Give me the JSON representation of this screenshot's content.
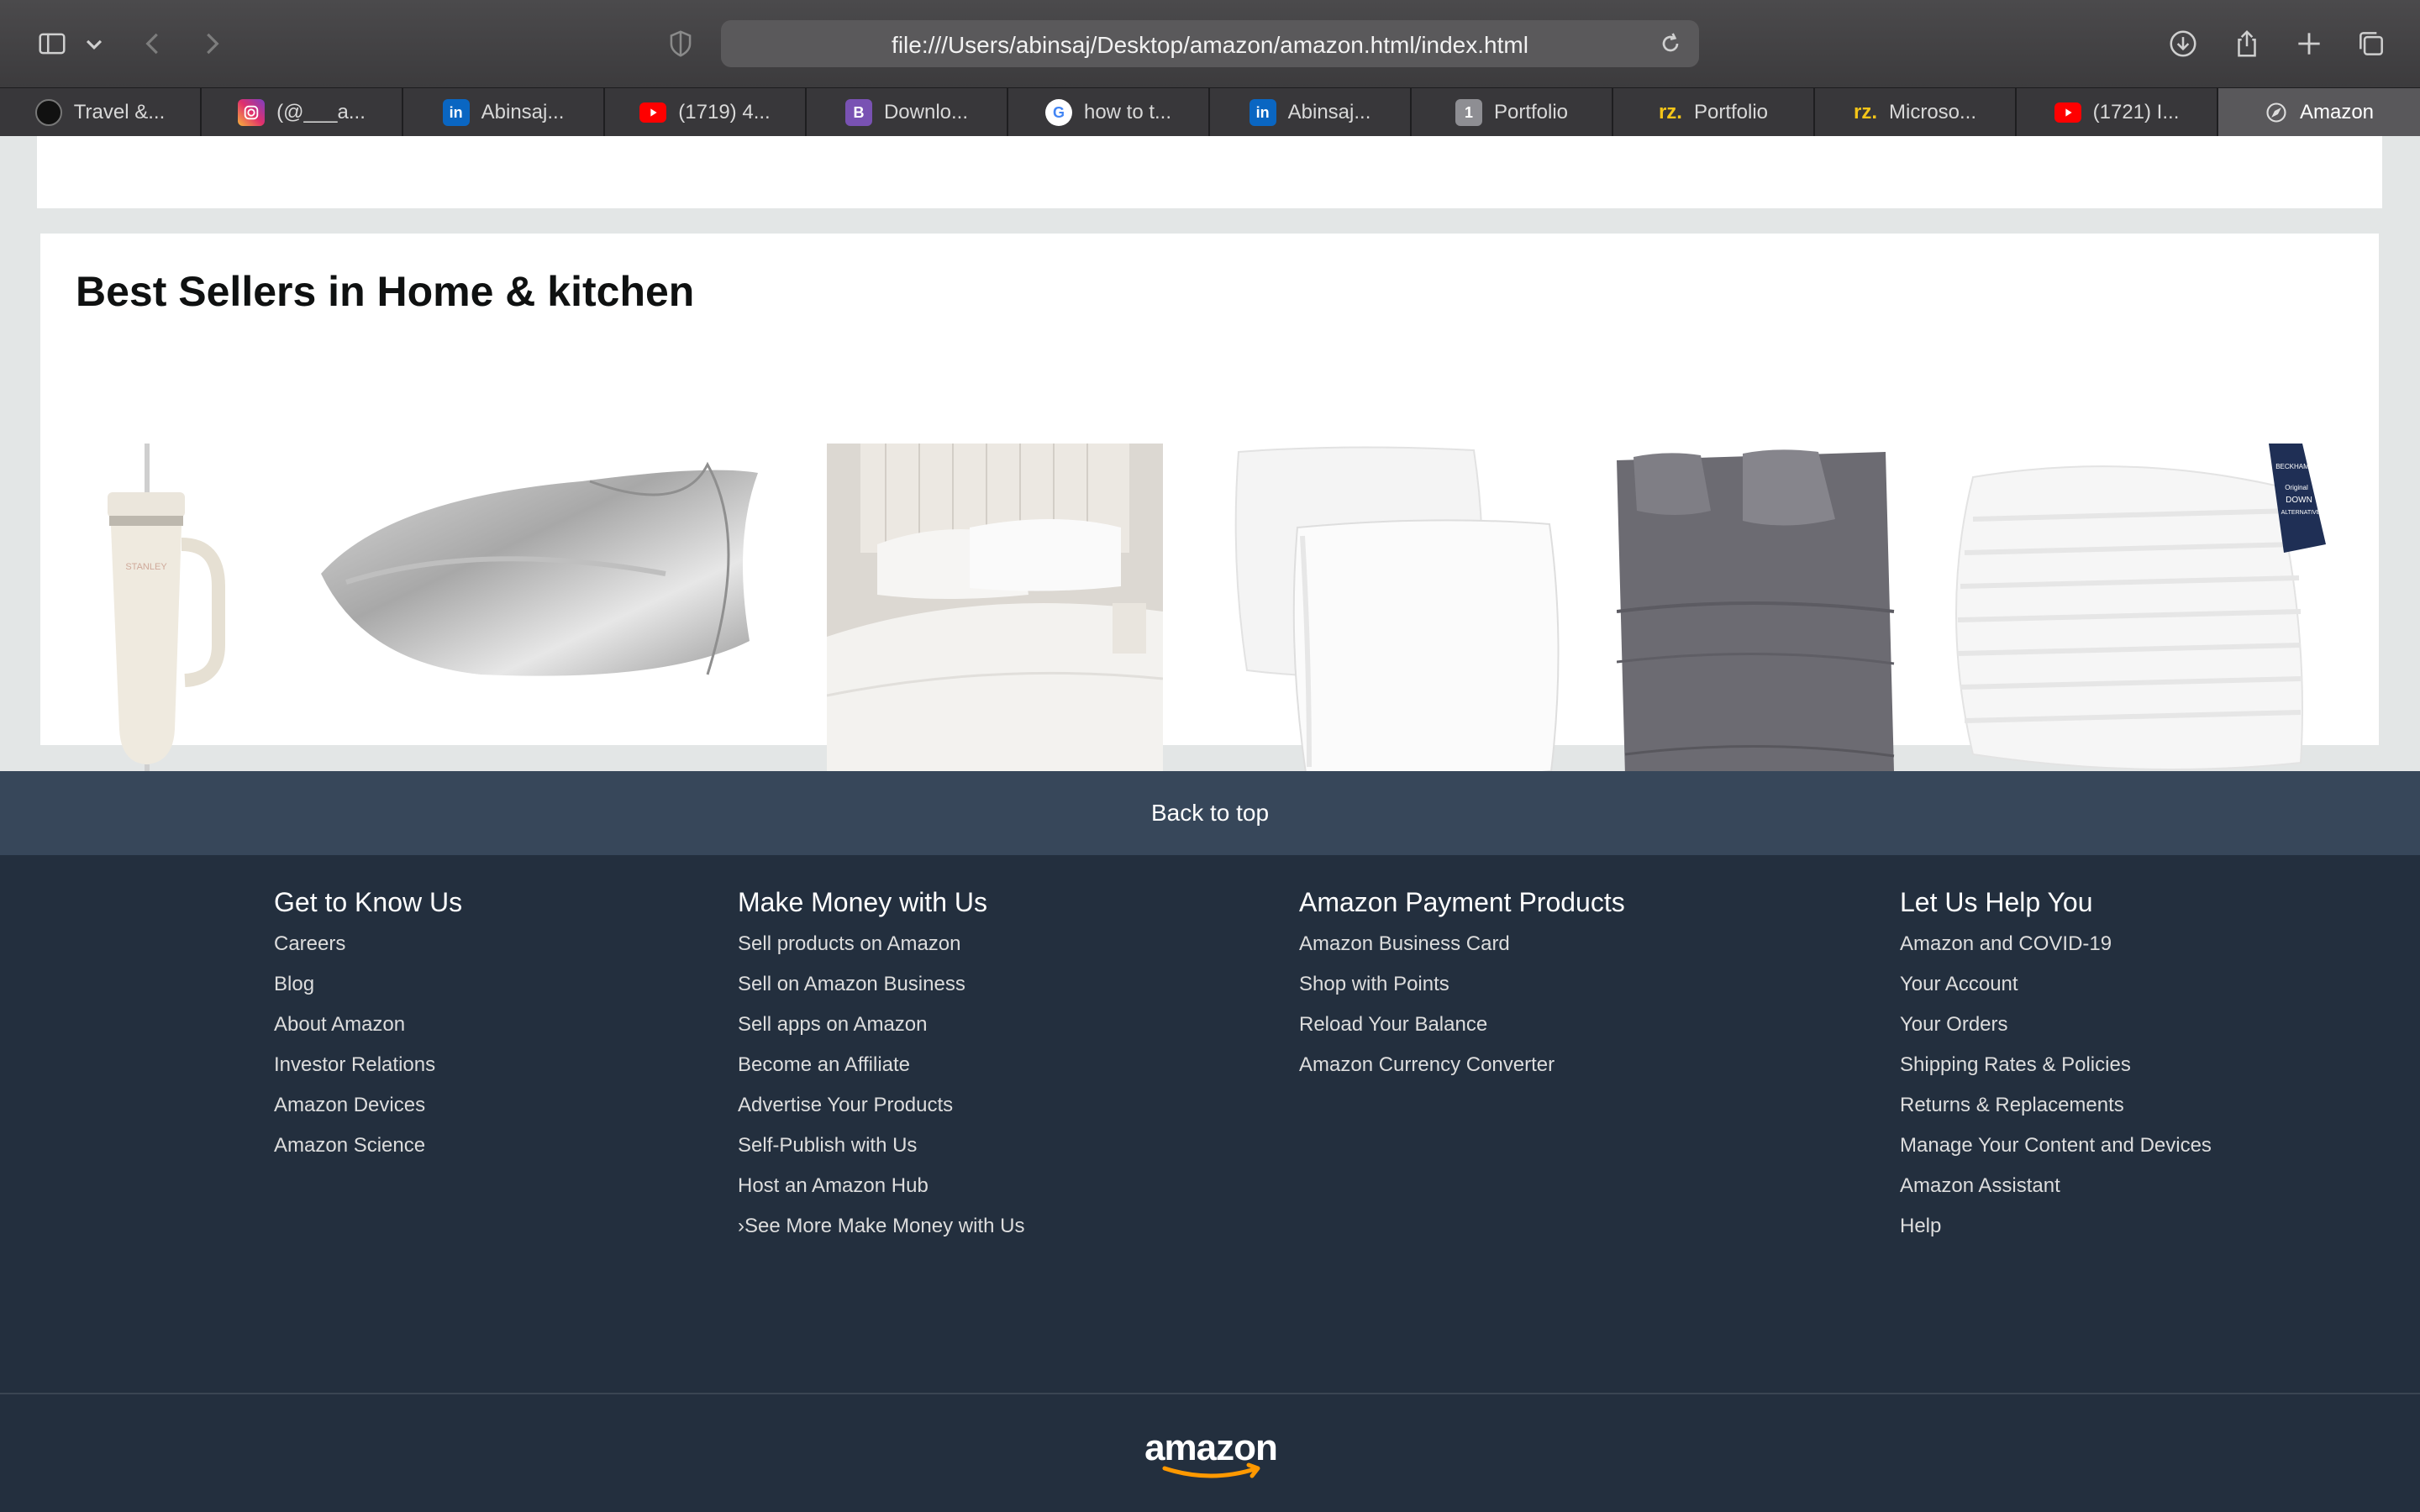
{
  "browser": {
    "url": "file:///Users/abinsaj/Desktop/amazon/amazon.html/index.html",
    "tabs": [
      {
        "label": "Travel &...",
        "icon": "travel-favicon-icon"
      },
      {
        "label": "(@___a...",
        "icon": "instagram-icon"
      },
      {
        "label": "Abinsaj...",
        "icon": "linkedin-icon"
      },
      {
        "label": "(1719) 4...",
        "icon": "youtube-icon"
      },
      {
        "label": "Downlo...",
        "icon": "bootstrap-icon"
      },
      {
        "label": "how to t...",
        "icon": "google-icon"
      },
      {
        "label": "Abinsaj...",
        "icon": "linkedin-icon"
      },
      {
        "label": "Portfolio",
        "icon": "portfolio-one-icon"
      },
      {
        "label": "Portfolio",
        "icon": "rz-icon"
      },
      {
        "label": "Microso...",
        "icon": "rz-icon"
      },
      {
        "label": "(1721) I...",
        "icon": "youtube-icon"
      },
      {
        "label": "Amazon",
        "icon": "compass-icon"
      }
    ],
    "favicon_text": {
      "linkedin": "in",
      "bootstrap": "B",
      "google": "G",
      "portfolio_one": "1",
      "rz": "rz."
    }
  },
  "best_sellers": {
    "title": "Best Sellers in Home & kitchen",
    "products": [
      {
        "name": "tumbler-image",
        "brand_print": "STANLEY"
      },
      {
        "name": "satin-pillowcase-image"
      },
      {
        "name": "bed-sheet-set-image"
      },
      {
        "name": "throw-pillows-image"
      },
      {
        "name": "grey-sheet-set-image"
      },
      {
        "name": "striped-pillows-image",
        "tag_print": [
          "BECKHAM",
          "Original",
          "DOWN",
          "ALTERNATIVE"
        ]
      }
    ]
  },
  "footer": {
    "back_to_top": "Back to top",
    "columns": [
      {
        "title": "Get to Know Us",
        "links": [
          "Careers",
          "Blog",
          "About Amazon",
          "Investor Relations",
          "Amazon Devices",
          "Amazon Science"
        ]
      },
      {
        "title": "Make Money with Us",
        "links": [
          "Sell products on Amazon",
          "Sell on Amazon Business",
          "Sell apps on Amazon",
          "Become an Affiliate",
          "Advertise Your Products",
          "Self-Publish with Us",
          "Host an Amazon Hub",
          "›See More Make Money with Us"
        ]
      },
      {
        "title": "Amazon Payment Products",
        "links": [
          "Amazon Business Card",
          "Shop with Points",
          "Reload Your Balance",
          "Amazon Currency Converter"
        ]
      },
      {
        "title": "Let Us Help You",
        "links": [
          "Amazon and COVID-19",
          "Your Account",
          "Your Orders",
          "Shipping Rates & Policies",
          "Returns & Replacements",
          "Manage Your Content and Devices",
          "Amazon Assistant",
          "Help"
        ]
      }
    ],
    "logo_text": "amazon"
  },
  "colors": {
    "footer_bg": "#232f3e",
    "back_to_top_bg": "#37475a",
    "logo_arrow": "#ff9900"
  }
}
